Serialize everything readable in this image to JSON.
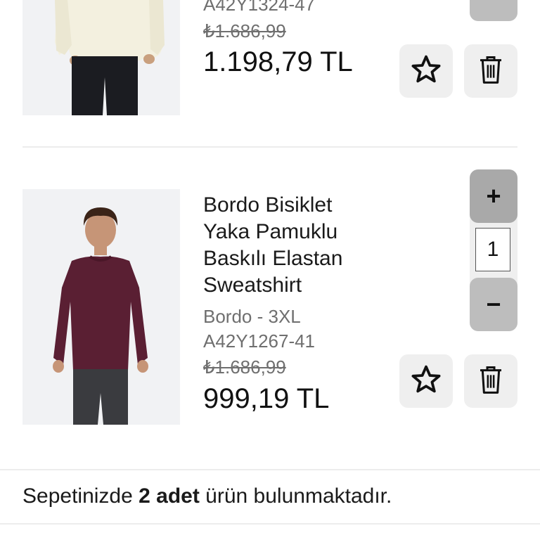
{
  "item1": {
    "code": "A42Y1324-47",
    "old_price": "₺1.686,99",
    "price": "1.198,79 TL",
    "colors": {
      "sweater": "#f3f0df",
      "pants": "#1b1c21",
      "bg": "#f1f2f4"
    }
  },
  "item2": {
    "title_lines": [
      "Bordo Bisiklet",
      "Yaka Pamuklu",
      "Baskılı Elastan",
      "Sweatshirt"
    ],
    "variant": "Bordo - 3XL",
    "code": "A42Y1267-41",
    "old_price": "₺1.686,99",
    "price": "999,19 TL",
    "quantity": "1",
    "plus_label": "+",
    "minus_label": "−",
    "colors": {
      "sweater": "#5a1f33",
      "pants": "#3a3b3f",
      "bg": "#f1f2f4"
    }
  },
  "summary": {
    "prefix": "Sepetinizde ",
    "count": "2 adet",
    "suffix": " ürün bulunmaktadır."
  },
  "icons": {
    "favorite": "star-icon",
    "delete": "trash-icon"
  }
}
